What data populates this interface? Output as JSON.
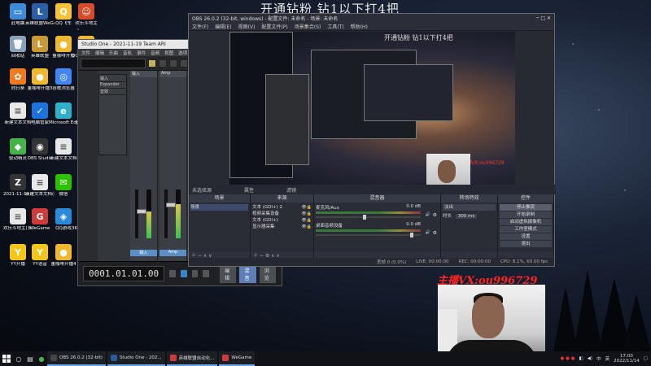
{
  "overlay_title": "开通钻粉 钻1以下打4把",
  "anchor_contact": "主播VX:ou996729",
  "desktop_icons": [
    {
      "label": "此电脑",
      "color": "#3d8bd8",
      "glyph": "▭"
    },
    {
      "label": "英雄联盟WeGame版",
      "color": "#2a5fa8",
      "glyph": "L"
    },
    {
      "label": "QQ飞车",
      "color": "#f6c23a",
      "glyph": "Q"
    },
    {
      "label": "欢乐斗地主",
      "color": "#d84a2a",
      "glyph": "☺"
    },
    {
      "label": "回收站",
      "color": "#8aa1b8",
      "glyph": "🗑"
    },
    {
      "label": "英雄联盟",
      "color": "#c99a34",
      "glyph": "L"
    },
    {
      "label": "董咖啡开播",
      "color": "#f0b830",
      "glyph": "●"
    },
    {
      "label": "QQ飞车助手工具",
      "color": "#f0b830",
      "glyph": "Q"
    },
    {
      "label": "向日葵",
      "color": "#f07a1e",
      "glyph": "✿"
    },
    {
      "label": "董咖啡开播3",
      "color": "#f0b830",
      "glyph": "●"
    },
    {
      "label": "谷歌浏览器",
      "color": "#4285f4",
      "glyph": "◎"
    },
    {
      "label": "鲁大师",
      "color": "#1f89dd",
      "glyph": "▲"
    },
    {
      "label": "新建文本文档",
      "color": "#e8e8e8",
      "glyph": "≡"
    },
    {
      "label": "电脑管家",
      "color": "#1a74dc",
      "glyph": "✓"
    },
    {
      "label": "Microsoft Edge",
      "color": "#2fb0c8",
      "glyph": "e"
    },
    {
      "label": "剪映专业版",
      "color": "#111111",
      "glyph": "✂"
    },
    {
      "label": "驱动精灵",
      "color": "#46b24a",
      "glyph": "◆"
    },
    {
      "label": "OBS Studio",
      "color": "#333333",
      "glyph": "◉"
    },
    {
      "label": "新建文本文档",
      "color": "#e8e8e8",
      "glyph": "≡"
    },
    {
      "label": "腾讯QQ",
      "color": "#1a1a1a",
      "glyph": "☻"
    },
    {
      "label": "2021-11-19 Team ARI",
      "color": "#333333",
      "glyph": "Z"
    },
    {
      "label": "新建文本文档(4)",
      "color": "#e8e8e8",
      "glyph": "≡"
    },
    {
      "label": "微信",
      "color": "#2dc100",
      "glyph": "✉"
    },
    {
      "label": "QQ音乐",
      "color": "#f5c518",
      "glyph": "♪"
    },
    {
      "label": "欢乐斗地主(多开)",
      "color": "#e8e8e8",
      "glyph": "≡"
    },
    {
      "label": "WeGame",
      "color": "#d13a3a",
      "glyph": "G"
    },
    {
      "label": "QQ游戏",
      "color": "#2a8ad8",
      "glyph": "◈"
    },
    {
      "label": "360安全浏览器",
      "color": "#4caf50",
      "glyph": "e"
    },
    {
      "label": "YY开播",
      "color": "#f5c518",
      "glyph": "Y"
    },
    {
      "label": "YY语音",
      "color": "#f5c518",
      "glyph": "Y"
    },
    {
      "label": "董咖啡开播4",
      "color": "#f0b830",
      "glyph": "●"
    }
  ],
  "studio_one": {
    "title": "Studio One - 2021-11-19 Team ARI",
    "menu": [
      "文件",
      "编辑",
      "乐曲",
      "音轨",
      "事件",
      "音频",
      "视图",
      "选项",
      "帮助"
    ],
    "panel_items": [
      "输入",
      "Expander",
      "音效"
    ],
    "strip_names": [
      "输入",
      "Amp",
      "主"
    ],
    "timecode": "0001.01.01.00",
    "tabs": [
      "编辑",
      "混音",
      "浏览"
    ],
    "active_tab": "混音",
    "levels": [
      0.55,
      0.7,
      0.6
    ]
  },
  "obs": {
    "title": "OBS 26.0.2 (32-bit, windows) - 配置文件: 未命名 - 场景: 未命名",
    "menu": [
      "文件(F)",
      "编辑(E)",
      "视图(V)",
      "配置文件(P)",
      "场景集合(S)",
      "工具(T)",
      "帮助(H)"
    ],
    "preview_caption": "开通钻粉 钻1以下打4把",
    "preview_red": "主播VX:ou996729",
    "scene_bar": [
      "未选择源",
      "属性",
      "滤镜"
    ],
    "docks": {
      "scenes": {
        "title": "场景",
        "items": [
          "场景"
        ]
      },
      "sources": {
        "title": "来源",
        "items": [
          "文本 (GDI+) 2",
          "视频采集设备",
          "文本 (GDI+)",
          "显示器采集"
        ]
      },
      "mixer": {
        "title": "混音器",
        "channels": [
          {
            "name": "麦克风/Aux",
            "db": "0.0 dB",
            "level": 0.45
          },
          {
            "name": "桌面音频设备",
            "db": "0.0 dB",
            "level": 0.9
          }
        ]
      },
      "transitions": {
        "title": "转场特效",
        "type": "淡出",
        "duration_label": "时长",
        "duration": "300 ms"
      },
      "controls": {
        "title": "控件",
        "buttons": [
          "停止推流",
          "开始录制",
          "启动虚拟摄像机",
          "工作室模式",
          "设置",
          "退出"
        ]
      }
    },
    "status": [
      "丢帧 0 (0.0%)",
      "LIVE: 00:00:00",
      "REC: 00:00:00",
      "CPU: 8.1%, 60.00 fps"
    ]
  },
  "taskbar": {
    "apps": [
      {
        "label": "OBS 26.0.2 (32-bit)",
        "color": "#444444"
      },
      {
        "label": "Studio One - 202...",
        "color": "#2a5a9a"
      },
      {
        "label": "英雄联盟自动化...",
        "color": "#d13a3a"
      },
      {
        "label": "WeGame",
        "color": "#d13a3a"
      }
    ],
    "time": "17:00",
    "date": "2022/11/14",
    "ime": "中",
    "lang": "英"
  }
}
